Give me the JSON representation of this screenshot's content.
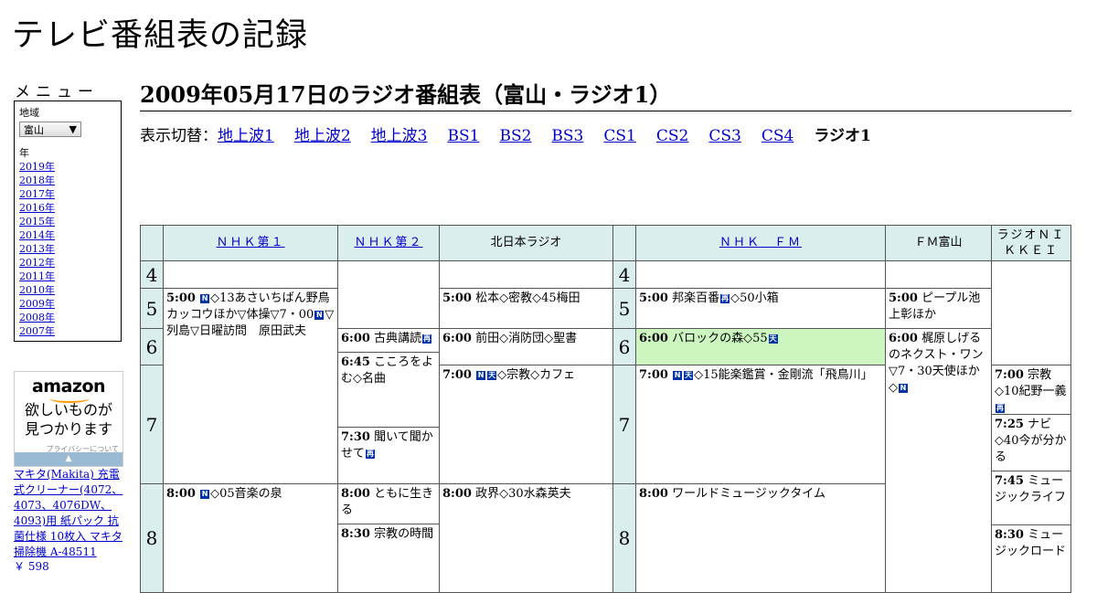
{
  "site": {
    "title": "テレビ番組表の記録"
  },
  "menu": {
    "label": "メニュー",
    "region_label": "地域",
    "region_selected": "富山",
    "year_label": "年",
    "years": [
      "2019年",
      "2018年",
      "2017年",
      "2016年",
      "2015年",
      "2014年",
      "2013年",
      "2012年",
      "2011年",
      "2010年",
      "2009年",
      "2008年",
      "2007年"
    ]
  },
  "ad": {
    "logo": "amazon",
    "copy_line1": "欲しいものが",
    "copy_line2": "見つかります",
    "privacy": "プライバシーについて",
    "product": "マキタ(Makita) 充電式クリーナー(4072、4073、4076DW、4093)用 紙パック 抗菌仕様 10枚入 マキタ 掃除機 A-48511",
    "price": "￥ 598"
  },
  "page": {
    "heading": "2009年05月17日のラジオ番組表（富山・ラジオ1）",
    "switch_label": "表示切替：",
    "switch_links": [
      "地上波1",
      "地上波2",
      "地上波3",
      "BS1",
      "BS2",
      "BS3",
      "CS1",
      "CS2",
      "CS3",
      "CS4"
    ],
    "switch_current": "ラジオ1"
  },
  "colors": {
    "header_bg": "#dbeeee",
    "highlight_bg": "#ccf5c0",
    "link": "#0000cc",
    "icon_bg": "#0033aa"
  },
  "schedule": {
    "channels": [
      "ＮＨＫ第１",
      "ＮＨＫ第２",
      "北日本ラジオ",
      "ＮＨＫ　ＦＭ",
      "ＦＭ富山",
      "ラジオＮＩＫＫＥＩ"
    ],
    "hours_left": [
      "4",
      "5",
      "6",
      "7",
      "8"
    ],
    "hours_right": [
      "4",
      "5",
      "6",
      "7",
      "8"
    ],
    "programs": {
      "nhk1_500_time": "5:00",
      "nhk1_500_text": "◇13あさいちばん野鳥カッコウほか▽体操▽7・00",
      "nhk1_500_text2": "▽列島▽日曜訪問　原田武夫",
      "nhk1_800_time": "8:00",
      "nhk1_800_text": "◇05音楽の泉",
      "nhk2_600_time": "6:00",
      "nhk2_600_text": "古典講読",
      "nhk2_645_time": "6:45",
      "nhk2_645_text": "こころをよむ◇名曲",
      "nhk2_730_time": "7:30",
      "nhk2_730_text": "聞いて聞かせて",
      "nhk2_800_time": "8:00",
      "nhk2_800_text": "ともに生きる",
      "nhk2_830_time": "8:30",
      "nhk2_830_text": "宗教の時間",
      "knb_500_time": "5:00",
      "knb_500_text": "松本◇密教◇45梅田",
      "knb_600_time": "6:00",
      "knb_600_text": "前田◇消防団◇聖書",
      "knb_700_time": "7:00",
      "knb_700_text": "◇宗教◇カフェ",
      "knb_800_time": "8:00",
      "knb_800_text": "政界◇30水森英夫",
      "fm_500_time": "5:00",
      "fm_500_text": "邦楽百番",
      "fm_500_text2": "◇50小箱",
      "fm_600_time": "6:00",
      "fm_600_text": "バロックの森◇55",
      "fm_700_time": "7:00",
      "fm_700_text": "◇15能楽鑑賞・金剛流「飛鳥川」",
      "fm_800_time": "8:00",
      "fm_800_text": "ワールドミュージックタイム",
      "fmt_500_time": "5:00",
      "fmt_500_text": "ピープル池上彰ほか",
      "fmt_600_time": "6:00",
      "fmt_600_text": "梶原しげるのネクスト・ワン▽7・30天使ほか◇",
      "nikkei_700_time": "7:00",
      "nikkei_700_text": "宗教◇10紀野一義",
      "nikkei_725_time": "7:25",
      "nikkei_725_text": "ナビ◇40今が分かる",
      "nikkei_745_time": "7:45",
      "nikkei_745_text": "ミュージックライフ",
      "nikkei_830_time": "8:30",
      "nikkei_830_text": "ミュージックロード"
    },
    "icons": {
      "news": "N",
      "weather": "天",
      "rebroadcast": "再"
    }
  }
}
